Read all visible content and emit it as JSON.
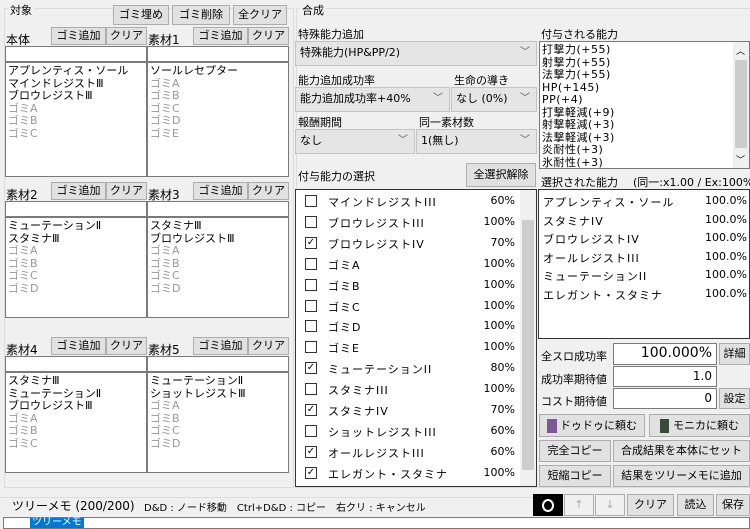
{
  "target": {
    "title": "対象",
    "fill_trash": "ゴミ埋め",
    "delete_trash": "ゴミ削除",
    "clear_all": "全クリア",
    "slots": [
      {
        "label": "本体",
        "add": "ゴミ追加",
        "clear": "クリア",
        "items": [
          {
            "t": "アプレンティス・ソール",
            "g": false
          },
          {
            "t": "マインドレジストⅢ",
            "g": false
          },
          {
            "t": "ブロウレジストⅢ",
            "g": false
          },
          {
            "t": "ゴミA",
            "g": true
          },
          {
            "t": "ゴミB",
            "g": true
          },
          {
            "t": "ゴミC",
            "g": true
          }
        ]
      },
      {
        "label": "素材1",
        "add": "ゴミ追加",
        "clear": "クリア",
        "items": [
          {
            "t": "ソールレセプター",
            "g": false
          },
          {
            "t": "ゴミA",
            "g": true
          },
          {
            "t": "ゴミB",
            "g": true
          },
          {
            "t": "ゴミC",
            "g": true
          },
          {
            "t": "ゴミD",
            "g": true
          },
          {
            "t": "ゴミE",
            "g": true
          }
        ]
      },
      {
        "label": "素材2",
        "add": "ゴミ追加",
        "clear": "クリア",
        "items": [
          {
            "t": "ミューテーションⅡ",
            "g": false
          },
          {
            "t": "スタミナⅢ",
            "g": false
          },
          {
            "t": "ゴミA",
            "g": true
          },
          {
            "t": "ゴミB",
            "g": true
          },
          {
            "t": "ゴミC",
            "g": true
          },
          {
            "t": "ゴミD",
            "g": true
          }
        ]
      },
      {
        "label": "素材3",
        "add": "ゴミ追加",
        "clear": "クリア",
        "items": [
          {
            "t": "スタミナⅢ",
            "g": false
          },
          {
            "t": "ブロウレジストⅢ",
            "g": false
          },
          {
            "t": "ゴミA",
            "g": true
          },
          {
            "t": "ゴミB",
            "g": true
          },
          {
            "t": "ゴミC",
            "g": true
          },
          {
            "t": "ゴミD",
            "g": true
          }
        ]
      },
      {
        "label": "素材4",
        "add": "ゴミ追加",
        "clear": "クリア",
        "items": [
          {
            "t": "スタミナⅢ",
            "g": false
          },
          {
            "t": "ミューテーションⅡ",
            "g": false
          },
          {
            "t": "ブロウレジストⅢ",
            "g": false
          },
          {
            "t": "ゴミA",
            "g": true
          },
          {
            "t": "ゴミB",
            "g": true
          },
          {
            "t": "ゴミC",
            "g": true
          }
        ]
      },
      {
        "label": "素材5",
        "add": "ゴミ追加",
        "clear": "クリア",
        "items": [
          {
            "t": "ミューテーションⅡ",
            "g": false
          },
          {
            "t": "ショットレジストⅢ",
            "g": false
          },
          {
            "t": "ゴミA",
            "g": true
          },
          {
            "t": "ゴミB",
            "g": true
          },
          {
            "t": "ゴミC",
            "g": true
          },
          {
            "t": "ゴミD",
            "g": true
          }
        ]
      }
    ]
  },
  "synth": {
    "title": "合成",
    "special_label": "特殊能力追加",
    "special_value": "特殊能力(HP&PP/2)",
    "rate_label": "能力追加成功率",
    "rate_value": "能力追加成功率+40%",
    "life_label": "生命の導き",
    "life_value": "なし (0%)",
    "reward_label": "報酬期間",
    "reward_value": "なし",
    "same_label": "同一素材数",
    "same_value": "1(無し)",
    "select_label": "付与能力の選択",
    "deselect_all": "全選択解除",
    "abilities": [
      {
        "name": "マインドレジストIII",
        "pct": "60%",
        "checked": false
      },
      {
        "name": "ブロウレジストIII",
        "pct": "100%",
        "checked": false
      },
      {
        "name": "ブロウレジストIV",
        "pct": "70%",
        "checked": true
      },
      {
        "name": "ゴミA",
        "pct": "100%",
        "checked": false
      },
      {
        "name": "ゴミB",
        "pct": "100%",
        "checked": false
      },
      {
        "name": "ゴミC",
        "pct": "100%",
        "checked": false
      },
      {
        "name": "ゴミD",
        "pct": "100%",
        "checked": false
      },
      {
        "name": "ゴミE",
        "pct": "100%",
        "checked": false
      },
      {
        "name": "ミューテーションII",
        "pct": "80%",
        "checked": true
      },
      {
        "name": "スタミナIII",
        "pct": "100%",
        "checked": false
      },
      {
        "name": "スタミナIV",
        "pct": "70%",
        "checked": true
      },
      {
        "name": "ショットレジストIII",
        "pct": "60%",
        "checked": false
      },
      {
        "name": "オールレジストIII",
        "pct": "60%",
        "checked": true
      },
      {
        "name": "エレガント・スタミナ",
        "pct": "100%",
        "checked": true
      }
    ]
  },
  "granted": {
    "label": "付与される能力",
    "items": [
      "打撃力(+55)",
      "射撃力(+55)",
      "法撃力(+55)",
      "HP(+145)",
      "PP(+4)",
      "打撃軽減(+9)",
      "射撃軽減(+3)",
      "法撃軽減(+3)",
      "炎耐性(+3)",
      "氷耐性(+3)"
    ]
  },
  "selected": {
    "label": "選択された能力",
    "info": "(同一:x1.00 / Ex:100%",
    "items": [
      {
        "name": "アプレンティス・ソール",
        "pct": "100.0%"
      },
      {
        "name": "スタミナIV",
        "pct": "100.0%"
      },
      {
        "name": "ブロウレジストIV",
        "pct": "100.0%"
      },
      {
        "name": "オールレジストIII",
        "pct": "100.0%"
      },
      {
        "name": "ミューテーションII",
        "pct": "100.0%"
      },
      {
        "name": "エレガント・スタミナ",
        "pct": "100.0%"
      }
    ]
  },
  "stats": {
    "all_rate_label": "全スロ成功率",
    "all_rate": "100.000%",
    "detail": "詳細",
    "expect_label": "成功率期待値",
    "expect": "1.0",
    "cost_label": "コスト期待値",
    "cost": "0",
    "settings": "設定"
  },
  "actions": {
    "dudu": "ドゥドゥに頼む",
    "monica": "モニカに頼む",
    "full_copy": "完全コピー",
    "set_result": "合成結果を本体にセット",
    "short_copy": "短縮コピー",
    "add_tree": "結果をツリーメモに追加"
  },
  "tree": {
    "title": "ツリーメモ (200/200)",
    "help": "D&D : ノード移動　Ctrl+D&D : コピー　右クリ : キャンセル",
    "up": "↑",
    "down": "↓",
    "clear": "クリア",
    "load": "読込",
    "save": "保存",
    "root": "ツリーメモ"
  }
}
